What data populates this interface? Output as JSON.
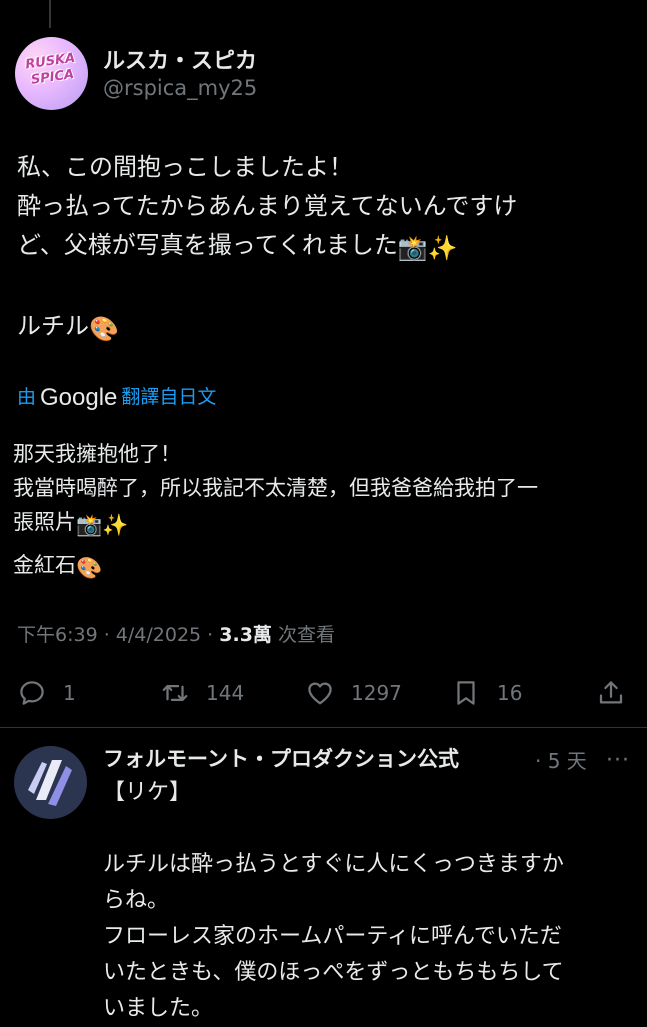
{
  "tweet": {
    "author": {
      "name": "ルスカ・スピカ",
      "handle": "@rspica_my25",
      "avatar_logo_text": "RUSKA SPICA"
    },
    "text_lines": [
      "私、この間抱っこしましたよ！",
      "酔っ払ってたからあんまり覚えてないんですけ",
      "ど、父様が写真を撮ってくれました"
    ],
    "text_tail_emojis": "📸✨",
    "signature": "ルチル",
    "signature_emoji": "🎨",
    "translation": {
      "prefix": "由",
      "provider": "Google",
      "suffix": "翻譯自日文",
      "lines": [
        "那天我擁抱他了！",
        "我當時喝醉了，所以我記不太清楚，但我爸爸給我拍了一",
        "張照片"
      ],
      "tail_emojis": "📸✨",
      "signature": "金紅石",
      "signature_emoji": "🎨"
    },
    "meta": {
      "time": "下午6:39",
      "date": "4/4/2025",
      "views": "3.3萬",
      "views_label": "次查看"
    },
    "actions": {
      "replies": "1",
      "retweets": "144",
      "likes": "1297",
      "bookmarks": "16"
    }
  },
  "reply": {
    "author_name": "フォルモーント・プロダクション公式",
    "time": "· 5 天",
    "lines": [
      "【リケ】",
      "",
      "ルチルは酔っ払うとすぐに人にくっつきますか",
      "らね。",
      "フローレス家のホームパーティに呼んでいただ",
      "いたときも、僕のほっぺをずっともちもちして",
      "いました。"
    ]
  },
  "icons": {
    "reply": "reply-icon",
    "retweet": "retweet-icon",
    "like": "heart-icon",
    "bookmark": "bookmark-icon",
    "share": "share-icon",
    "more": "more-icon"
  },
  "colors": {
    "background": "#000000",
    "text": "#e7e9ea",
    "muted": "#71767b",
    "link": "#1d9bf0"
  }
}
